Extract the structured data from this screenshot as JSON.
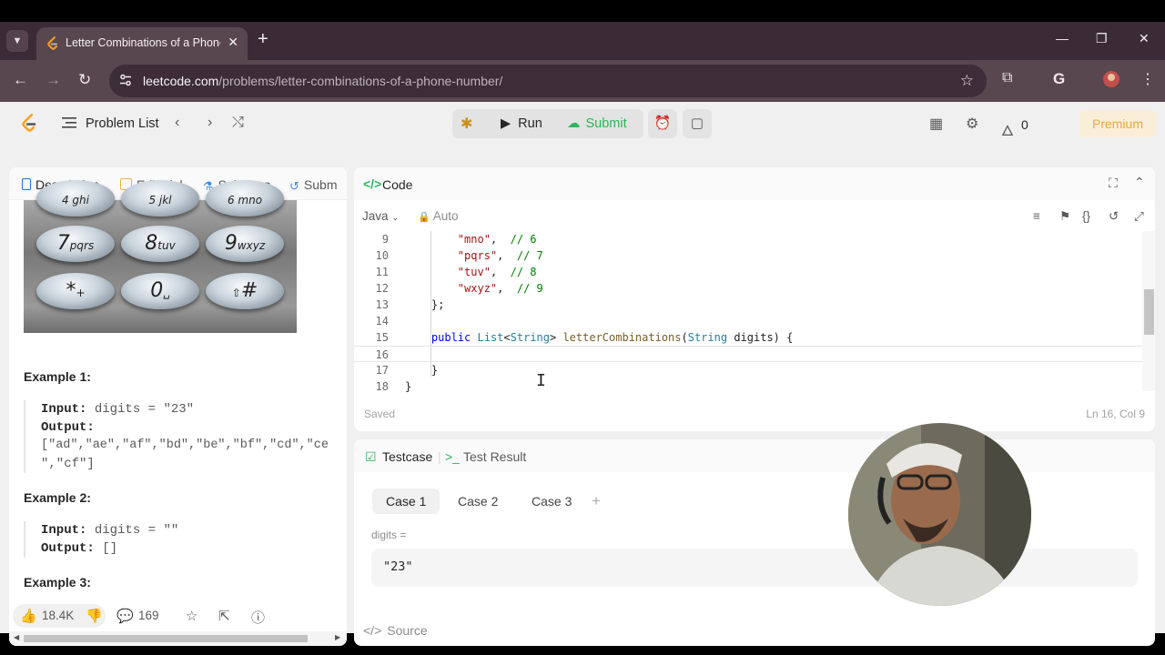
{
  "browser": {
    "tab_title": "Letter Combinations of a Phone Number - LeetCode",
    "url_domain": "leetcode.com",
    "url_path": "/problems/letter-combinations-of-a-phone-number/"
  },
  "header": {
    "problem_list": "Problem List",
    "run": "Run",
    "submit": "Submit",
    "streak_count": "0",
    "premium": "Premium"
  },
  "left": {
    "tabs": [
      "Description",
      "Editorial",
      "Solutions",
      "Subm"
    ],
    "keypad_keys": [
      {
        "digit": "7",
        "letters": "pqrs"
      },
      {
        "digit": "8",
        "letters": "tuv"
      },
      {
        "digit": "9",
        "letters": "wxyz"
      },
      {
        "digit": "*",
        "letters": "+"
      },
      {
        "digit": "0",
        "letters": "␣"
      },
      {
        "digit": "#",
        "letters": "⇧"
      }
    ],
    "examples": [
      {
        "title": "Example 1:",
        "input_label": "Input:",
        "input": "digits = \"23\"",
        "output_label": "Output:",
        "output_line1": "[\"ad\",\"ae\",\"af\",\"bd\",\"be\",\"bf\",\"cd\",\"ce",
        "output_line2": "\",\"cf\"]"
      },
      {
        "title": "Example 2:",
        "input_label": "Input:",
        "input": "digits = \"\"",
        "output_label": "Output:",
        "output_line1": "[]"
      },
      {
        "title": "Example 3:"
      }
    ],
    "footer": {
      "likes": "18.4K",
      "comments": "169"
    }
  },
  "code": {
    "title": "Code",
    "language": "Java",
    "mode": "Auto",
    "status": "Saved",
    "cursor": "Ln 16, Col 9",
    "lines": [
      {
        "no": "9",
        "text": "        \"mno\",  // 6"
      },
      {
        "no": "10",
        "text": "        \"pqrs\",  // 7"
      },
      {
        "no": "11",
        "text": "        \"tuv\",  // 8"
      },
      {
        "no": "12",
        "text": "        \"wxyz\",  // 9"
      },
      {
        "no": "13",
        "text": "    };"
      },
      {
        "no": "14",
        "text": ""
      },
      {
        "no": "15",
        "text": "    public List<String> letterCombinations(String digits) {"
      },
      {
        "no": "16",
        "text": ""
      },
      {
        "no": "17",
        "text": "    }"
      },
      {
        "no": "18",
        "text": "}"
      }
    ]
  },
  "tests": {
    "tab_testcase": "Testcase",
    "tab_result": "Test Result",
    "cases": [
      "Case 1",
      "Case 2",
      "Case 3"
    ],
    "input_label": "digits =",
    "input_value": "\"23\"",
    "source": "Source"
  },
  "colors": {
    "accent_green": "#2db55d",
    "premium_orange": "#f0a63a",
    "browser_chrome": "#3a2b37"
  }
}
